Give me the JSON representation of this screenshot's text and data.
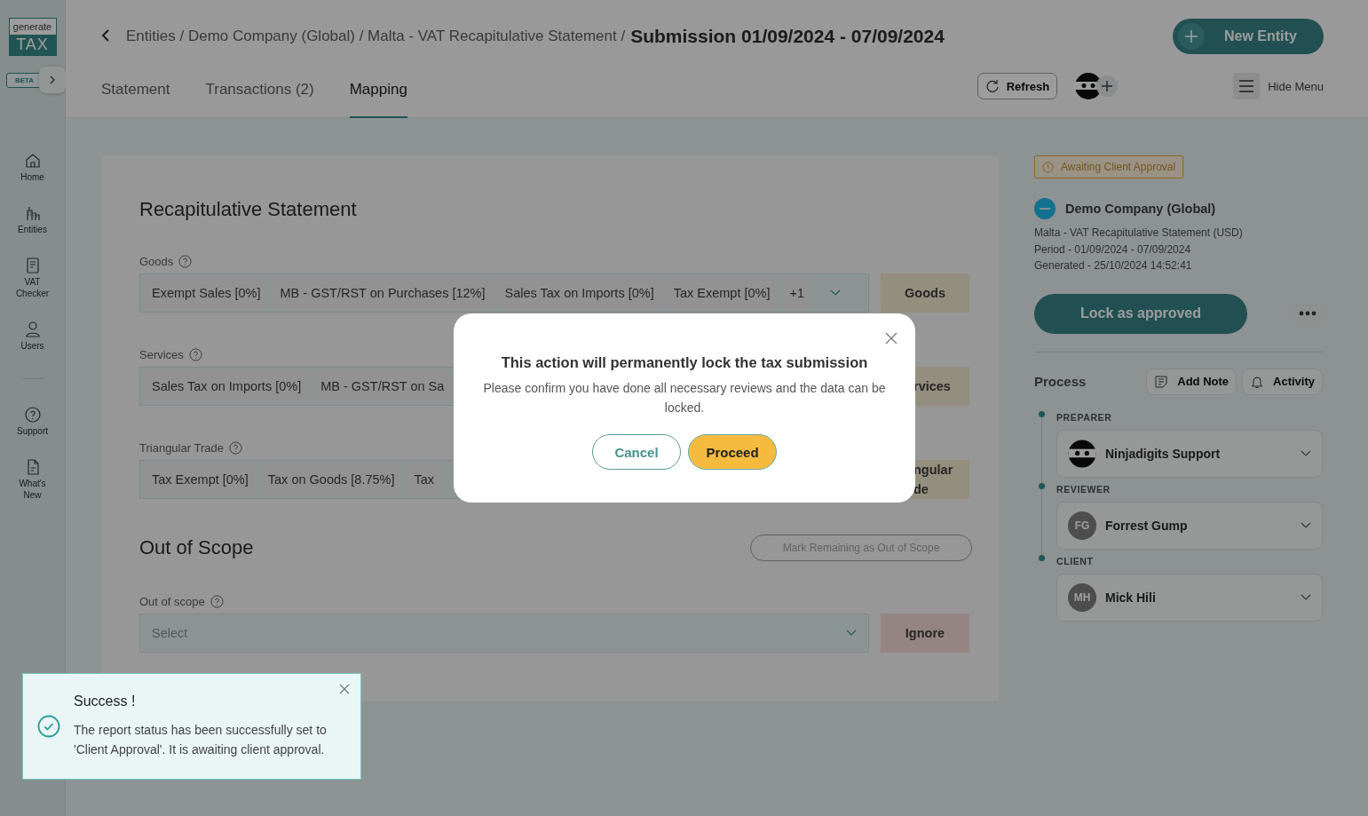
{
  "logo": {
    "top": "generate",
    "bottom": "TAX",
    "badge": "BETA"
  },
  "nav": [
    {
      "label": "Home",
      "kind": "home"
    },
    {
      "label": "Entities",
      "kind": "building"
    },
    {
      "label": "VAT Checker",
      "kind": "document"
    },
    {
      "label": "Users",
      "kind": "user"
    },
    {
      "label": "Support",
      "kind": "help"
    },
    {
      "label": "What's New",
      "kind": "file"
    }
  ],
  "breadcrumb": {
    "path": "Entities / Demo Company (Global) / Malta - VAT Recapitulative Statement /",
    "current": "Submission 01/09/2024 - 07/09/2024"
  },
  "new_entity": "New Entity",
  "tabs": [
    {
      "label": "Statement",
      "selected": false
    },
    {
      "label": "Transactions (2)",
      "selected": false
    },
    {
      "label": "Mapping",
      "selected": true
    }
  ],
  "refresh": "Refresh",
  "hide_menu": "Hide Menu",
  "statement": {
    "title": "Recapitulative Statement",
    "groups": [
      {
        "label": "Goods",
        "chips": [
          "Exempt Sales [0%]",
          "MB - GST/RST on Purchases [12%]",
          "Sales Tax on Imports [0%]",
          "Tax Exempt [0%]"
        ],
        "more": "+1",
        "action": "Goods"
      },
      {
        "label": "Services",
        "chips": [
          "Sales Tax on Imports [0%]",
          "MB - GST/RST on Sa"
        ],
        "action": "rvices"
      },
      {
        "label": "Triangular Trade",
        "chips": [
          "Tax Exempt [0%]",
          "Tax on Goods [8.75%]",
          "Tax"
        ],
        "action": "ngular de"
      }
    ]
  },
  "out_of_scope": {
    "title": "Out of Scope",
    "mark_button": "Mark Remaining as Out of Scope",
    "label": "Out of scope",
    "placeholder": "Select",
    "ignore": "Ignore"
  },
  "side": {
    "status": "Awaiting Client Approval",
    "company": "Demo Company (Global)",
    "details": [
      "Malta - VAT Recapitulative Statement (USD)",
      "Period - 01/09/2024 - 07/09/2024",
      "Generated - 25/10/2024 14:52:41"
    ],
    "lock": "Lock as approved",
    "process": "Process",
    "add_note": "Add Note",
    "activity": "Activity",
    "steps": [
      {
        "role": "PREPARER",
        "name": "Ninjadigits Support",
        "kind": "ninja"
      },
      {
        "role": "REVIEWER",
        "name": "Forrest Gump",
        "kind": "initials",
        "initials": "FG"
      },
      {
        "role": "CLIENT",
        "name": "Mick Hili",
        "kind": "initials",
        "initials": "MH"
      }
    ]
  },
  "modal": {
    "title": "This action will permanently lock the tax submission",
    "body": "Please confirm you have done all necessary reviews and the data can be locked.",
    "cancel": "Cancel",
    "proceed": "Proceed"
  },
  "toast": {
    "title": "Success !",
    "body": "The report status has been successfully set to 'Client Approval'. It is awaiting client approval."
  }
}
